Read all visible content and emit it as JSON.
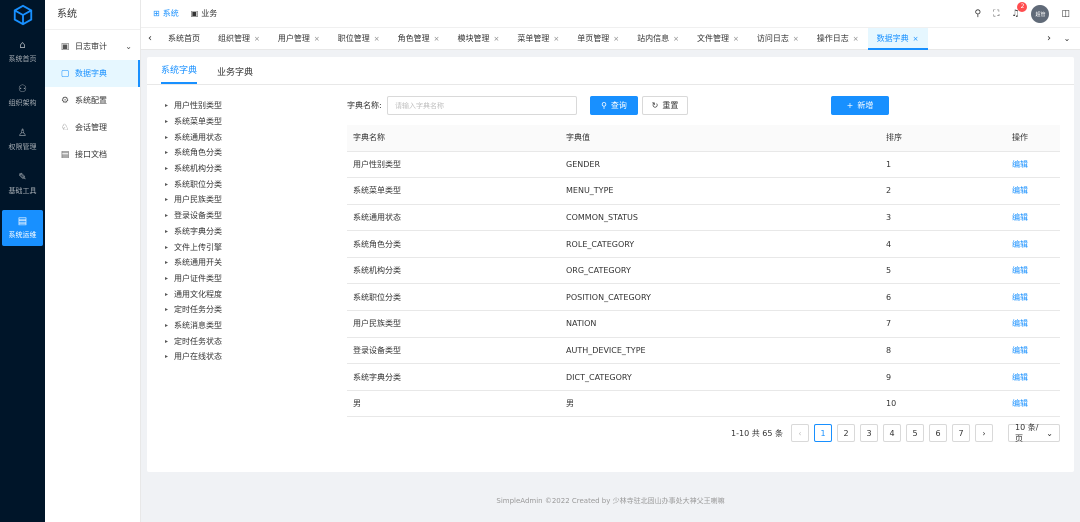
{
  "rail": {
    "items": [
      {
        "label": "系统首页",
        "icon": "⌂",
        "icon_name": "home-icon",
        "active": false
      },
      {
        "label": "组织架构",
        "icon": "⚇",
        "icon_name": "org-tree-icon",
        "active": false
      },
      {
        "label": "权限管理",
        "icon": "♙",
        "icon_name": "user-permission-icon",
        "active": false
      },
      {
        "label": "基础工具",
        "icon": "✎",
        "icon_name": "tool-icon",
        "active": false
      },
      {
        "label": "系统运维",
        "icon": "▤",
        "icon_name": "ops-icon",
        "active": true
      }
    ]
  },
  "side": {
    "title": "系统",
    "items": [
      {
        "label": "日志审计",
        "icon": "▣",
        "icon_name": "log-icon",
        "chevron": "⌄",
        "active": false
      },
      {
        "label": "数据字典",
        "icon": "▢",
        "icon_name": "dictionary-icon",
        "active": true
      },
      {
        "label": "系统配置",
        "icon": "⚙",
        "icon_name": "gear-icon",
        "active": false
      },
      {
        "label": "会话管理",
        "icon": "♘",
        "icon_name": "session-icon",
        "active": false
      },
      {
        "label": "接口文档",
        "icon": "▤",
        "icon_name": "document-icon",
        "active": false
      }
    ]
  },
  "header": {
    "top_tabs": [
      {
        "label": "系统",
        "icon": "⊞",
        "active": true
      },
      {
        "label": "业务",
        "icon": "▣",
        "active": false
      }
    ],
    "notification_count": "2",
    "avatar_text": "超管",
    "icons": {
      "search": "⚲",
      "fullscreen": "⛶",
      "bell": "♫",
      "layout": "◫"
    }
  },
  "tabs": {
    "prev": "‹",
    "next": "›",
    "more": "⌄",
    "close": "×",
    "items": [
      {
        "label": "系统首页",
        "closable": false,
        "active": false
      },
      {
        "label": "组织管理",
        "closable": true,
        "active": false
      },
      {
        "label": "用户管理",
        "closable": true,
        "active": false
      },
      {
        "label": "职位管理",
        "closable": true,
        "active": false
      },
      {
        "label": "角色管理",
        "closable": true,
        "active": false
      },
      {
        "label": "模块管理",
        "closable": true,
        "active": false
      },
      {
        "label": "菜单管理",
        "closable": true,
        "active": false
      },
      {
        "label": "单页管理",
        "closable": true,
        "active": false
      },
      {
        "label": "站内信息",
        "closable": true,
        "active": false
      },
      {
        "label": "文件管理",
        "closable": true,
        "active": false
      },
      {
        "label": "访问日志",
        "closable": true,
        "active": false
      },
      {
        "label": "操作日志",
        "closable": true,
        "active": false
      },
      {
        "label": "数据字典",
        "closable": true,
        "active": true
      }
    ]
  },
  "subtabs": [
    {
      "label": "系统字典",
      "active": true
    },
    {
      "label": "业务字典",
      "active": false
    }
  ],
  "tree": {
    "caret": "▸",
    "items": [
      "用户性别类型",
      "系统菜单类型",
      "系统通用状态",
      "系统角色分类",
      "系统机构分类",
      "系统职位分类",
      "用户民族类型",
      "登录设备类型",
      "系统字典分类",
      "文件上传引擎",
      "系统通用开关",
      "用户证件类型",
      "通用文化程度",
      "定时任务分类",
      "系统消息类型",
      "定时任务状态",
      "用户在线状态"
    ]
  },
  "search": {
    "label": "字典名称:",
    "placeholder": "请输入字典名称",
    "value": "",
    "query_label": "查询",
    "reset_label": "重置",
    "add_label": "新增"
  },
  "table": {
    "headers": {
      "name": "字典名称",
      "value": "字典值",
      "sort": "排序",
      "op": "操作"
    },
    "action_label": "编辑",
    "rows": [
      {
        "name": "用户性别类型",
        "value": "GENDER",
        "sort": "1"
      },
      {
        "name": "系统菜单类型",
        "value": "MENU_TYPE",
        "sort": "2"
      },
      {
        "name": "系统通用状态",
        "value": "COMMON_STATUS",
        "sort": "3"
      },
      {
        "name": "系统角色分类",
        "value": "ROLE_CATEGORY",
        "sort": "4"
      },
      {
        "name": "系统机构分类",
        "value": "ORG_CATEGORY",
        "sort": "5"
      },
      {
        "name": "系统职位分类",
        "value": "POSITION_CATEGORY",
        "sort": "6"
      },
      {
        "name": "用户民族类型",
        "value": "NATION",
        "sort": "7"
      },
      {
        "name": "登录设备类型",
        "value": "AUTH_DEVICE_TYPE",
        "sort": "8"
      },
      {
        "name": "系统字典分类",
        "value": "DICT_CATEGORY",
        "sort": "9"
      },
      {
        "name": "男",
        "value": "男",
        "sort": "10"
      }
    ]
  },
  "pagination": {
    "total_text": "1-10 共 65 条",
    "prev": "‹",
    "next": "›",
    "pages": [
      "1",
      "2",
      "3",
      "4",
      "5",
      "6",
      "7"
    ],
    "current": "1",
    "page_size": "10 条/页",
    "page_size_arrow": "⌄"
  },
  "footer": {
    "text": "SimpleAdmin ©2022 Created by 少林寺驻北固山办事处大神父王喇嘛"
  },
  "colors": {
    "primary": "#1890ff",
    "rail_bg": "#001529",
    "danger": "#ff4d4f"
  }
}
